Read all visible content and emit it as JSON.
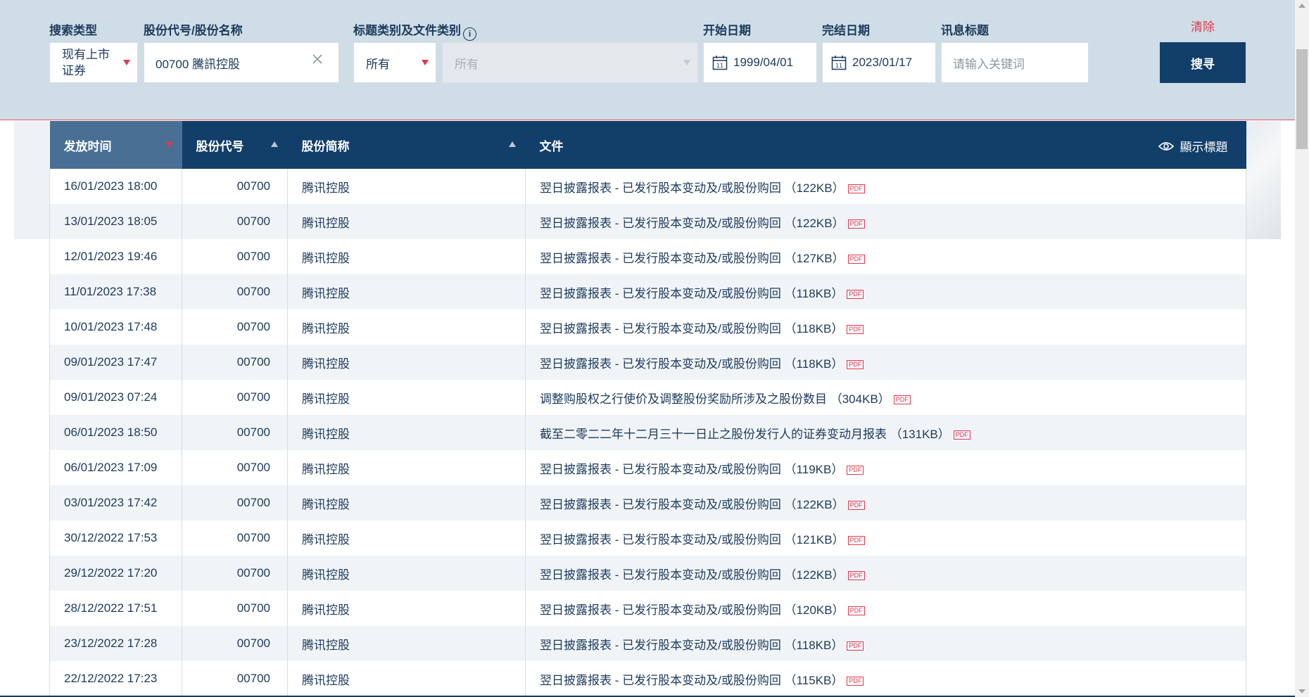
{
  "search": {
    "type_label": "搜索类型",
    "type_value": "现有上市证券",
    "stock_label": "股份代号/股份名称",
    "stock_value": "00700 騰訊控股",
    "category_label": "标题类别及文件类别",
    "category_value": "所有",
    "doc_type_value": "所有",
    "start_label": "开始日期",
    "start_value": "1999/04/01",
    "end_label": "完结日期",
    "end_value": "2023/01/17",
    "keyword_label": "讯息标题",
    "keyword_placeholder": "请输入关键词",
    "clear_label": "清除",
    "search_button": "搜寻"
  },
  "table": {
    "headers": {
      "time": "发放时间",
      "code": "股份代号",
      "name": "股份简称",
      "doc": "文件",
      "show_titles": "顯示標題"
    },
    "pdf_label": "PDF",
    "rows": [
      {
        "time": "16/01/2023 18:00",
        "code": "00700",
        "name": "腾讯控股",
        "doc": "翌日披露报表 - 已发行股本变动及/或股份购回 （122KB）"
      },
      {
        "time": "13/01/2023 18:05",
        "code": "00700",
        "name": "腾讯控股",
        "doc": "翌日披露报表 - 已发行股本变动及/或股份购回 （122KB）"
      },
      {
        "time": "12/01/2023 19:46",
        "code": "00700",
        "name": "腾讯控股",
        "doc": "翌日披露报表 - 已发行股本变动及/或股份购回 （127KB）"
      },
      {
        "time": "11/01/2023 17:38",
        "code": "00700",
        "name": "腾讯控股",
        "doc": "翌日披露报表 - 已发行股本变动及/或股份购回 （118KB）"
      },
      {
        "time": "10/01/2023 17:48",
        "code": "00700",
        "name": "腾讯控股",
        "doc": "翌日披露报表 - 已发行股本变动及/或股份购回 （118KB）"
      },
      {
        "time": "09/01/2023 17:47",
        "code": "00700",
        "name": "腾讯控股",
        "doc": "翌日披露报表 - 已发行股本变动及/或股份购回 （118KB）"
      },
      {
        "time": "09/01/2023 07:24",
        "code": "00700",
        "name": "腾讯控股",
        "doc": "调整购股权之行使价及调整股份奖励所涉及之股份数目 （304KB）"
      },
      {
        "time": "06/01/2023 18:50",
        "code": "00700",
        "name": "腾讯控股",
        "doc": "截至二零二二年十二月三十一日止之股份发行人的证券变动月报表 （131KB）"
      },
      {
        "time": "06/01/2023 17:09",
        "code": "00700",
        "name": "腾讯控股",
        "doc": "翌日披露报表 - 已发行股本变动及/或股份购回 （119KB）"
      },
      {
        "time": "03/01/2023 17:42",
        "code": "00700",
        "name": "腾讯控股",
        "doc": "翌日披露报表 - 已发行股本变动及/或股份购回 （122KB）"
      },
      {
        "time": "30/12/2022 17:53",
        "code": "00700",
        "name": "腾讯控股",
        "doc": "翌日披露报表 - 已发行股本变动及/或股份购回 （121KB）"
      },
      {
        "time": "29/12/2022 17:20",
        "code": "00700",
        "name": "腾讯控股",
        "doc": "翌日披露报表 - 已发行股本变动及/或股份购回 （122KB）"
      },
      {
        "time": "28/12/2022 17:51",
        "code": "00700",
        "name": "腾讯控股",
        "doc": "翌日披露报表 - 已发行股本变动及/或股份购回 （120KB）"
      },
      {
        "time": "23/12/2022 17:28",
        "code": "00700",
        "name": "腾讯控股",
        "doc": "翌日披露报表 - 已发行股本变动及/或股份购回 （118KB）"
      },
      {
        "time": "22/12/2022 17:23",
        "code": "00700",
        "name": "腾讯控股",
        "doc": "翌日披露报表 - 已发行股本变动及/或股份购回 （115KB）"
      }
    ]
  },
  "colors": {
    "header_bg": "#123e6a",
    "accent_red": "#e0394f",
    "search_bar_bg": "#cfdde7"
  },
  "icons": [
    "calendar-icon",
    "info-icon",
    "clear-x-icon",
    "eye-icon",
    "pdf-icon",
    "dropdown-caret-icon"
  ]
}
